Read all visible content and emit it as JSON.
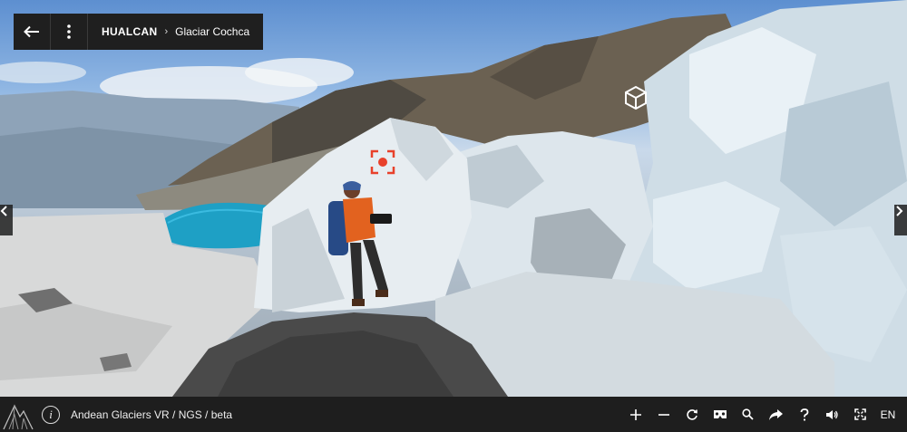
{
  "header": {
    "location": "HUALCAN",
    "separator": "›",
    "scene": "Glaciar Cochca"
  },
  "footer": {
    "title": "Andean Glaciers VR / NGS / beta",
    "info_label": "i",
    "language": "EN"
  },
  "icons": {
    "back": "arrow-left-icon",
    "menu": "more-vertical-icon",
    "hotspot_3d": "cube-icon",
    "hotspot_photo": "photo-target-icon",
    "nav_left": "chevron-left-icon",
    "nav_right": "chevron-right-icon",
    "tools": [
      "zoom-in-icon",
      "zoom-out-icon",
      "autorotate-icon",
      "vr-headset-icon",
      "search-icon",
      "share-icon",
      "help-icon",
      "volume-icon",
      "fullscreen-icon"
    ]
  },
  "colors": {
    "bar": "#1e1e1e",
    "accent": "#e8412b",
    "text": "#ffffff"
  }
}
